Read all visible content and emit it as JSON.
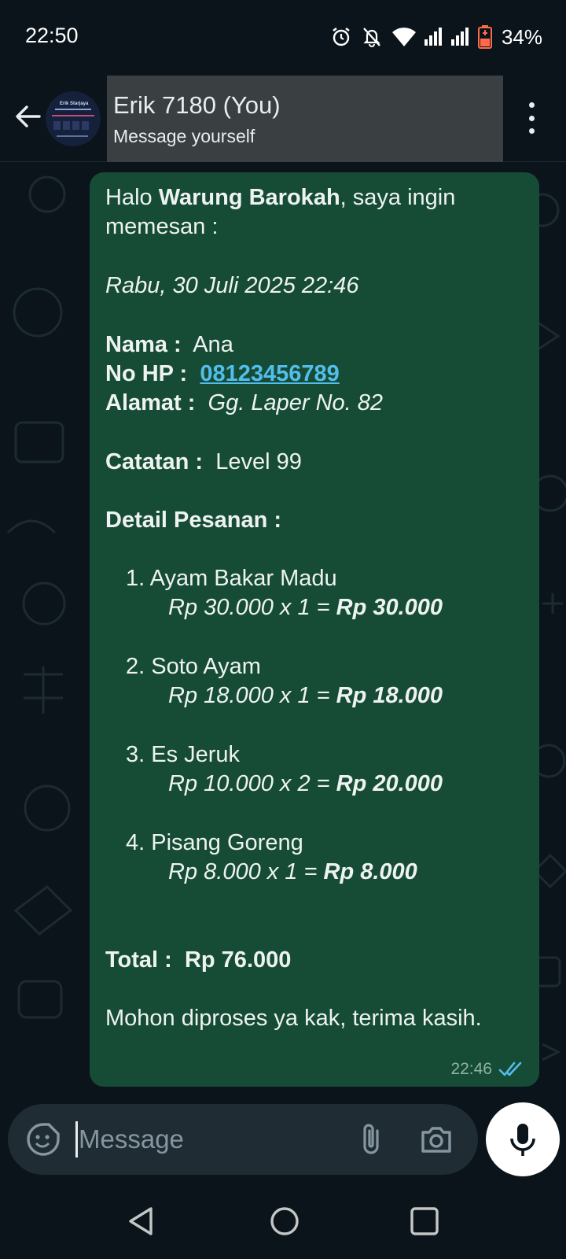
{
  "status_bar": {
    "time": "22:50",
    "battery": "34%",
    "icons": [
      "alarm-icon",
      "notifications-off-icon",
      "wifi-icon",
      "signal-icon",
      "signal-icon",
      "battery-icon"
    ]
  },
  "header": {
    "title": "Erik 7180 (You)",
    "subtitle": "Message yourself",
    "avatar_lines": [
      "Erik Starjaya"
    ]
  },
  "message": {
    "greeting_pre": "Halo ",
    "store_name": "Warung Barokah",
    "greeting_post": ", saya ingin",
    "greeting_line2": "memesan :",
    "date": "Rabu, 30 Juli 2025 22:46",
    "name_label": "Nama :",
    "name_value": "Ana",
    "phone_label": "No HP :",
    "phone_value": "08123456789",
    "address_label": "Alamat :",
    "address_value": "Gg. Laper No. 82",
    "note_label": "Catatan :",
    "note_value": "Level 99",
    "details_label": "Detail Pesanan :",
    "items": [
      {
        "name": "1. Ayam Bakar Madu",
        "calc": "Rp 30.000 x 1 = ",
        "subtotal": "Rp 30.000"
      },
      {
        "name": "2. Soto Ayam",
        "calc": "Rp 18.000 x 1 = ",
        "subtotal": "Rp 18.000"
      },
      {
        "name": "3. Es Jeruk",
        "calc": "Rp 10.000 x 2 = ",
        "subtotal": "Rp 20.000"
      },
      {
        "name": "4. Pisang Goreng",
        "calc": "Rp 8.000 x 1 = ",
        "subtotal": "Rp 8.000"
      }
    ],
    "total_label": "Total :",
    "total_value": "Rp 76.000",
    "closing": "Mohon diproses ya kak, terima kasih.",
    "time": "22:46",
    "read_color": "#53bdeb"
  },
  "composer": {
    "placeholder": "Message"
  },
  "colors": {
    "background": "#0b141a",
    "bubble": "#164c36",
    "link": "#53bdeb",
    "input": "#1f2c33"
  }
}
